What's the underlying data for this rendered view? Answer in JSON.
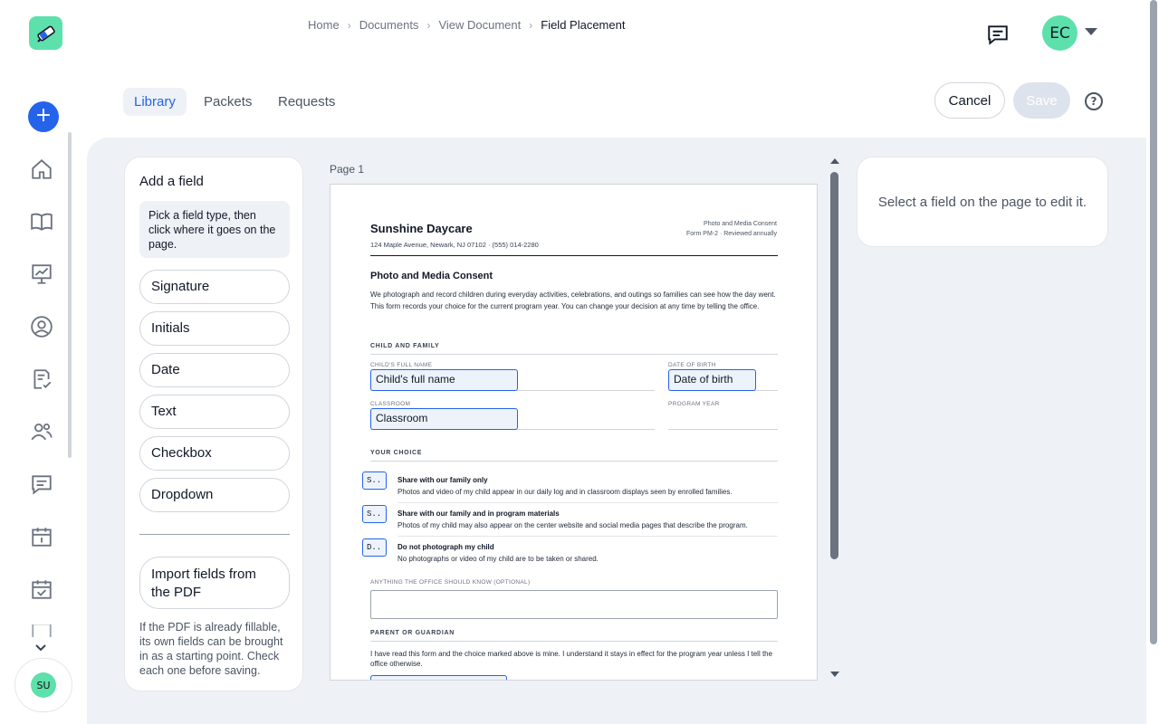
{
  "breadcrumbs": [
    "Home",
    "Documents",
    "View Document",
    "Field Placement"
  ],
  "user": {
    "initials": "EC",
    "rail_initials": "SU"
  },
  "tabs": [
    {
      "label": "Library",
      "active": true
    },
    {
      "label": "Packets",
      "active": false
    },
    {
      "label": "Requests",
      "active": false
    }
  ],
  "actions": {
    "cancel": "Cancel",
    "save": "Save",
    "help": "?"
  },
  "left_panel": {
    "title": "Add a field",
    "hint": "Pick a field type, then click where it goes on the page.",
    "field_types": [
      "Signature",
      "Initials",
      "Date",
      "Text",
      "Checkbox",
      "Dropdown"
    ],
    "import_label": "Import fields from the PDF",
    "import_note": "If the PDF is already fillable, its own fields can be brought in as a starting point. Check each one before saving."
  },
  "page_label": "Page 1",
  "right_panel": {
    "empty_text": "Select a field on the page to edit it."
  },
  "document": {
    "org": "Sunshine Daycare",
    "address": "124 Maple Avenue, Newark, NJ 07102  ·  (555) 014-2280",
    "form_title": "Photo and Media Consent",
    "form_meta": "Form PM-2  ·  Reviewed annually",
    "title": "Photo and Media Consent",
    "intro": "We photograph and record children during everyday activities, celebrations, and outings so families can see how the day went. This form records your choice for the current program year. You can change your decision at any time by telling the office.",
    "section_child": "CHILD AND FAMILY",
    "child_name_label": "CHILD'S FULL NAME",
    "dob_label": "DATE OF BIRTH",
    "classroom_label": "CLASSROOM",
    "program_year_label": "PROGRAM YEAR",
    "placed_fields": {
      "child_name": "Child's full name",
      "dob": "Date of birth",
      "classroom": "Classroom"
    },
    "section_choice": "YOUR CHOICE",
    "options": [
      {
        "marker": "S..",
        "title": "Share with our family only",
        "desc": "Photos and video of my child appear in our daily log and in classroom displays seen by enrolled families."
      },
      {
        "marker": "S..",
        "title": "Share with our family and in program materials",
        "desc": "Photos of my child may also appear on the center website and social media pages that describe the program."
      },
      {
        "marker": "D..",
        "title": "Do not photograph my child",
        "desc": "No photographs or video of my child are to be taken or shared."
      }
    ],
    "notes_label": "ANYTHING THE OFFICE SHOULD KNOW (OPTIONAL)",
    "section_parent": "PARENT OR GUARDIAN",
    "parent_text": "I have read this form and the choice marked above is mine. I understand it stays in effect for the program year unless I tell the office otherwise."
  },
  "colors": {
    "accent": "#2563eb",
    "brand": "#5ee0ac",
    "workspace_bg": "#eef1f6"
  }
}
